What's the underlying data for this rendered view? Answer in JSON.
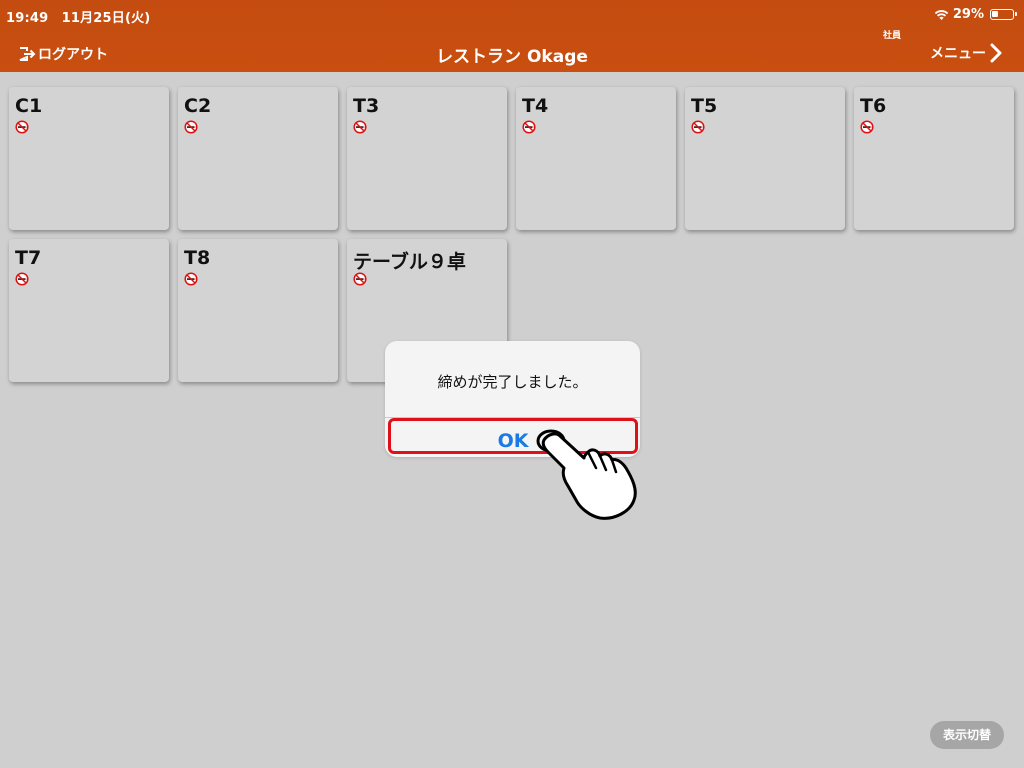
{
  "status_bar": {
    "time_date": "19:49　11月25日(火)",
    "battery": "29%"
  },
  "header": {
    "logout_label": "ログアウト",
    "title": "レストラン Okage",
    "role": "社員",
    "menu_label": "メニュー",
    "color": "#c84f10"
  },
  "tables": [
    {
      "name": "C1",
      "icon": "no-smoking-icon"
    },
    {
      "name": "C2",
      "icon": "no-smoking-icon"
    },
    {
      "name": "T3",
      "icon": "no-smoking-icon"
    },
    {
      "name": "T4",
      "icon": "no-smoking-icon"
    },
    {
      "name": "T5",
      "icon": "no-smoking-icon"
    },
    {
      "name": "T6",
      "icon": "no-smoking-icon"
    },
    {
      "name": "T7",
      "icon": "no-smoking-icon"
    },
    {
      "name": "T8",
      "icon": "no-smoking-icon"
    },
    {
      "name": "テーブル９卓",
      "icon": "no-smoking-icon"
    }
  ],
  "dialog": {
    "message": "締めが完了しました。",
    "ok_label": "OK",
    "highlight_color": "#e0101a",
    "ok_color": "#1a7ae6"
  },
  "footer": {
    "toggle_view_label": "表示切替"
  }
}
